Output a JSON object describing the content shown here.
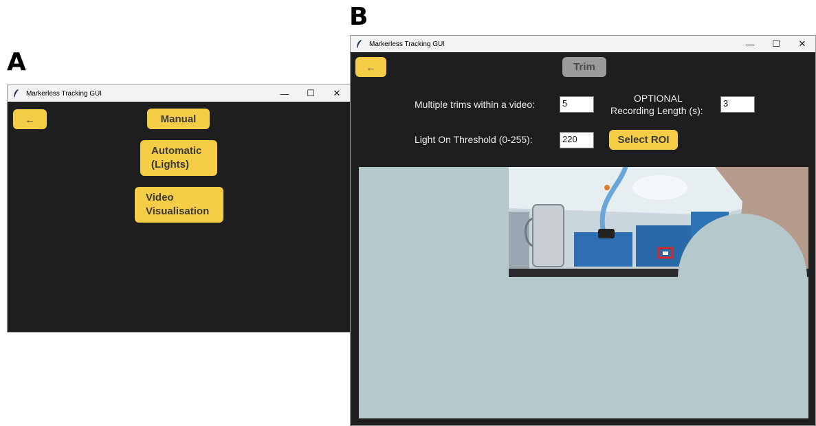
{
  "panels": {
    "a": {
      "letter": "A"
    },
    "b": {
      "letter": "B"
    }
  },
  "window_a": {
    "title": "Markerless Tracking GUI",
    "back_label": "←",
    "buttons": {
      "manual": "Manual",
      "automatic_line1": "Automatic",
      "automatic_line2": "(Lights)",
      "video_line1": "Video",
      "video_line2": "Visualisation"
    }
  },
  "window_b": {
    "title": "Markerless Tracking GUI",
    "back_label": "←",
    "trim_label": "Trim",
    "multiple_trims_label": "Multiple trims within a video:",
    "multiple_trims_value": "5",
    "optional_line1": "OPTIONAL",
    "optional_line2": "Recording Length (s):",
    "recording_length_value": "3",
    "light_threshold_label": "Light On Threshold (0-255):",
    "light_threshold_value": "220",
    "select_roi_label": "Select ROI"
  },
  "controls": {
    "minimize": "—",
    "maximize": "☐",
    "close": "✕"
  },
  "colors": {
    "window_bg": "#1e1e1e",
    "button_yellow": "#f5cc46",
    "button_disabled": "#9b9b9b",
    "canvas_bg": "#b5c9cb"
  },
  "icons": [
    "feather-icon",
    "minimize-icon",
    "maximize-icon",
    "close-icon",
    "back-arrow-icon"
  ]
}
